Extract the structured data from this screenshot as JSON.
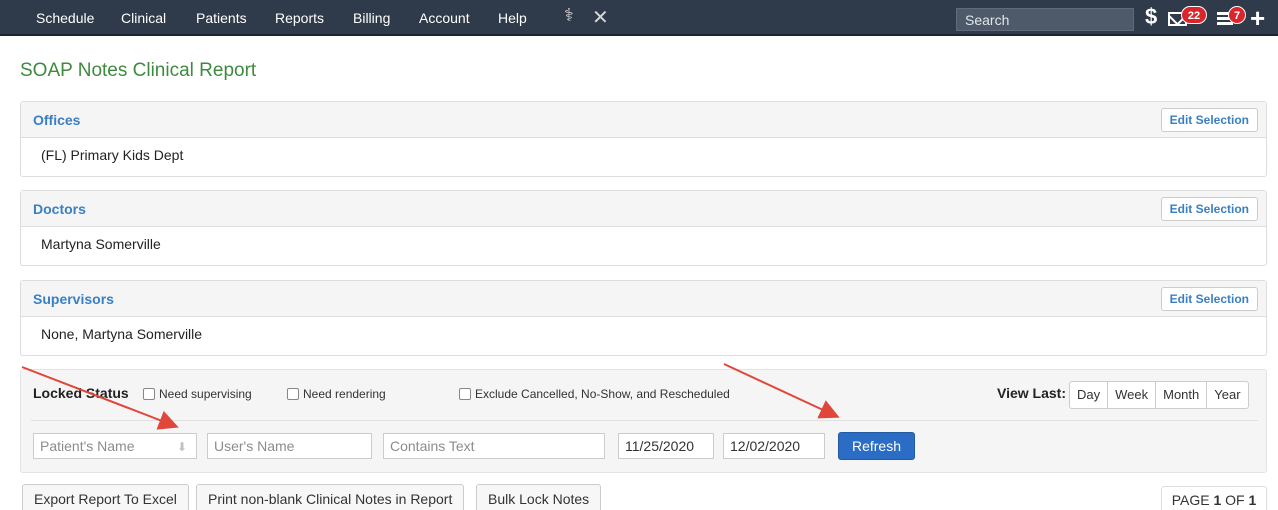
{
  "nav": {
    "items": [
      "Schedule",
      "Clinical",
      "Patients",
      "Reports",
      "Billing",
      "Account",
      "Help"
    ],
    "search_placeholder": "Search",
    "messages_count": "22",
    "tasks_count": "7"
  },
  "page_title": "SOAP Notes Clinical Report",
  "panels": {
    "offices": {
      "title": "Offices",
      "edit_label": "Edit Selection",
      "value": "(FL) Primary Kids Dept"
    },
    "doctors": {
      "title": "Doctors",
      "edit_label": "Edit Selection",
      "value": "Martyna Somerville"
    },
    "supervisors": {
      "title": "Supervisors",
      "edit_label": "Edit Selection",
      "value": "None, Martyna Somerville"
    }
  },
  "filters": {
    "locked_status_label": "Locked Status",
    "need_supervising": "Need supervising",
    "need_rendering": "Need rendering",
    "exclude_label": "Exclude Cancelled, No-Show, and Rescheduled",
    "view_last_label": "View Last:",
    "view_last_options": [
      "Day",
      "Week",
      "Month",
      "Year"
    ],
    "patient_placeholder": "Patient's Name",
    "user_placeholder": "User's Name",
    "contains_placeholder": "Contains Text",
    "date_from": "11/25/2020",
    "date_to": "12/02/2020",
    "refresh_label": "Refresh"
  },
  "actions": {
    "export_label": "Export Report To Excel",
    "print_label": "Print non-blank Clinical Notes in Report",
    "bulk_lock_label": "Bulk Lock Notes"
  },
  "pagination": {
    "prefix": "PAGE",
    "current": "1",
    "of": "OF",
    "total": "1"
  },
  "colors": {
    "nav_bg": "#2f3a4a",
    "title_green": "#3e8a3e",
    "link_blue": "#3a7fc2",
    "refresh_blue": "#2b6cc4",
    "badge_red": "#d9262b",
    "arrow_red": "#e0473a"
  }
}
